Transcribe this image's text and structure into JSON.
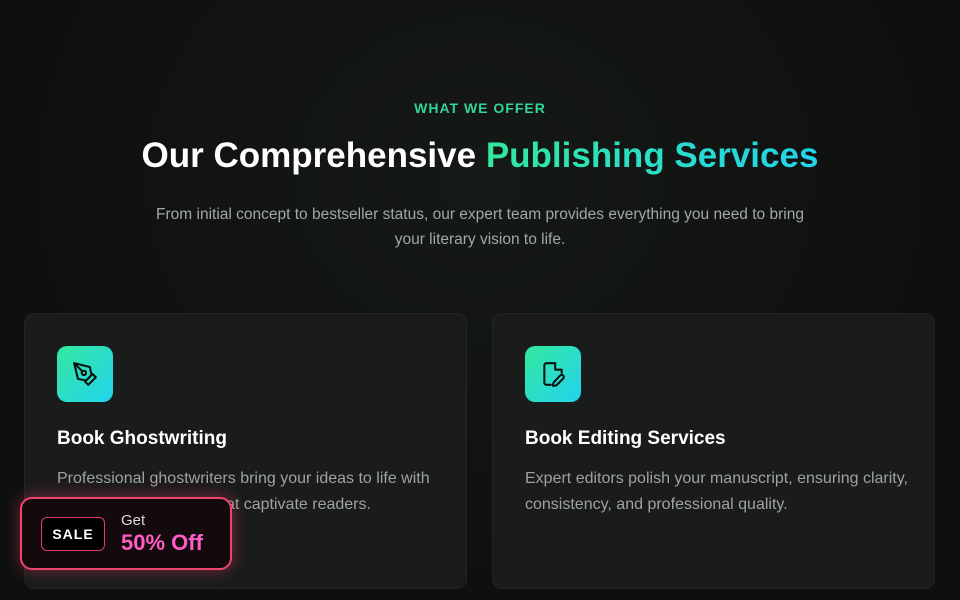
{
  "header": {
    "eyebrow": "WHAT WE OFFER",
    "title_plain": "Our Comprehensive ",
    "title_accent": "Publishing Services",
    "subtitle": "From initial concept to bestseller status, our expert team provides everything you need to bring your literary vision to life."
  },
  "services": [
    {
      "icon": "pen-nib-icon",
      "title": "Book Ghostwriting",
      "description": "Professional ghostwriters bring your ideas to life with compelling narratives that captivate readers."
    },
    {
      "icon": "file-edit-icon",
      "title": "Book Editing Services",
      "description": "Expert editors polish your manuscript, ensuring clarity, consistency, and professional quality."
    }
  ],
  "promo": {
    "badge": "SALE",
    "get_label": "Get",
    "discount": "50% Off"
  },
  "colors": {
    "accent_green": "#34e89e",
    "accent_cyan": "#22d3ee",
    "promo_border": "#f0446e",
    "promo_text": "#ff5cc8"
  }
}
